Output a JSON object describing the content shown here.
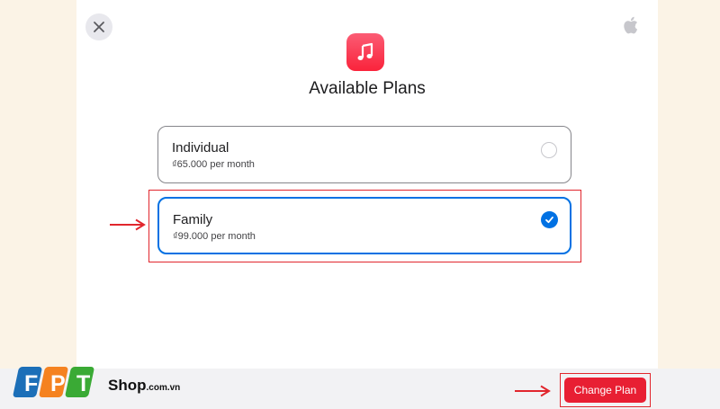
{
  "dialog": {
    "title": "Available Plans",
    "close_icon": "close-icon",
    "apple_icon": "apple-logo-icon",
    "app_icon": "music-note-icon"
  },
  "plans": [
    {
      "name": "Individual",
      "price": "₫65.000 per month",
      "selected": false
    },
    {
      "name": "Family",
      "price": "₫99.000 per month",
      "selected": true
    }
  ],
  "footer": {
    "change_plan_label": "Change Plan",
    "brand_letters": "FPT",
    "brand_shop": "Shop",
    "brand_domain": ".com.vn"
  },
  "colors": {
    "accent_blue": "#0071e3",
    "button_red": "#e81f33",
    "annotation_red": "#e1262d",
    "fpt_blue": "#1c6fb8",
    "fpt_orange": "#f58220",
    "fpt_green": "#3aaa35"
  }
}
